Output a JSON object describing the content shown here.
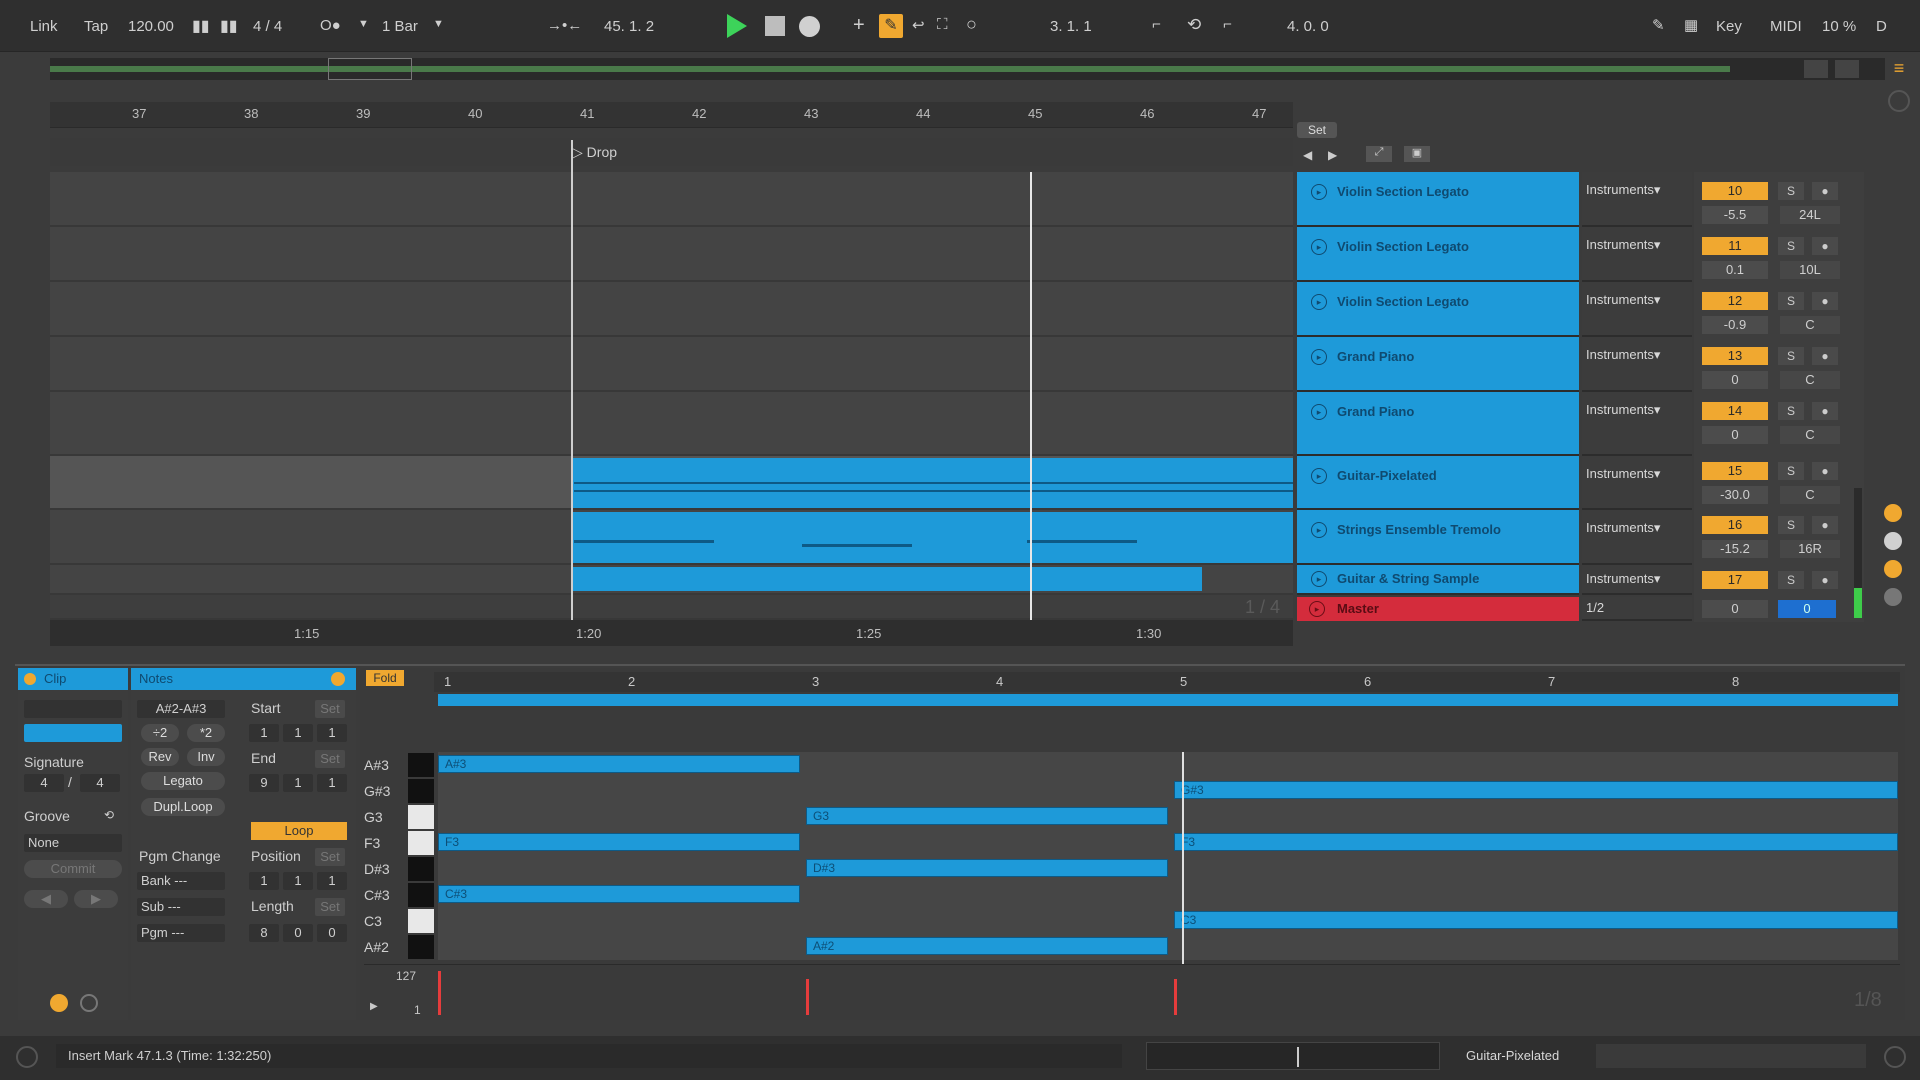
{
  "transport": {
    "link": "Link",
    "tap": "Tap",
    "tempo": "120.00",
    "signature": "4 / 4",
    "quantize": "1 Bar",
    "position": "45.  1.  2",
    "loop_start": "3.  1.  1",
    "loop_length": "4.  0.  0",
    "key_label": "Key",
    "midi_label": "MIDI",
    "cpu": "10 %",
    "disk": "D"
  },
  "arrangement": {
    "bar_numbers": [
      "37",
      "38",
      "39",
      "40",
      "41",
      "42",
      "43",
      "44",
      "45",
      "46",
      "47"
    ],
    "locator": "Drop",
    "time_labels": [
      "1:15",
      "1:20",
      "1:25",
      "1:30"
    ],
    "zoom_ratio": "1 / 4",
    "set_label": "Set"
  },
  "tracks": [
    {
      "name": "Violin Section Legato",
      "input": "Instruments▾",
      "number": "10",
      "volume": "-5.5",
      "pan": "24L"
    },
    {
      "name": "Violin Section Legato",
      "input": "Instruments▾",
      "number": "11",
      "volume": "0.1",
      "pan": "10L"
    },
    {
      "name": "Violin Section Legato",
      "input": "Instruments▾",
      "number": "12",
      "volume": "-0.9",
      "pan": "C"
    },
    {
      "name": "Grand Piano",
      "input": "Instruments▾",
      "number": "13",
      "volume": "0",
      "pan": "C"
    },
    {
      "name": "Grand Piano",
      "input": "Instruments▾",
      "number": "14",
      "volume": "0",
      "pan": "C"
    },
    {
      "name": "Guitar-Pixelated",
      "input": "Instruments▾",
      "number": "15",
      "volume": "-30.0",
      "pan": "C"
    },
    {
      "name": "Strings Ensemble Tremolo",
      "input": "Instruments▾",
      "number": "16",
      "volume": "-15.2",
      "pan": "16R"
    },
    {
      "name": "Guitar & String Sample",
      "input": "Instruments▾",
      "number": "17",
      "volume": "",
      "pan": ""
    }
  ],
  "master": {
    "name": "Master",
    "routing": "1/2",
    "volume": "0",
    "pan": "0",
    "solo_label": "S"
  },
  "clip_panel": {
    "title": "Clip",
    "signature_label": "Signature",
    "sig_num": "4",
    "sig_den": "4",
    "groove_label": "Groove",
    "groove_value": "None",
    "commit": "Commit"
  },
  "notes_panel": {
    "title": "Notes",
    "range": "A#2-A#3",
    "div2": "÷2",
    "mul2": "*2",
    "rev": "Rev",
    "inv": "Inv",
    "legato": "Legato",
    "dupl_loop": "Dupl.Loop",
    "pgm_change": "Pgm Change",
    "bank": "Bank ---",
    "sub": "Sub ---",
    "pgm": "Pgm ---",
    "start_label": "Start",
    "start_value": [
      "1",
      "1",
      "1"
    ],
    "end_label": "End",
    "end_value": [
      "9",
      "1",
      "1"
    ],
    "loop": "Loop",
    "position_label": "Position",
    "position_value": [
      "1",
      "1",
      "1"
    ],
    "length_label": "Length",
    "length_value": [
      "8",
      "0",
      "0"
    ],
    "set_label": "Set"
  },
  "piano_roll": {
    "fold": "Fold",
    "bars": [
      "1",
      "2",
      "3",
      "4",
      "5",
      "6",
      "7",
      "8"
    ],
    "keys": [
      "A#3",
      "G#3",
      "G3",
      "F3",
      "D#3",
      "C#3",
      "C3",
      "A#2"
    ],
    "notes": [
      "A#3",
      "G3",
      "D#3",
      "C#3",
      "A#2",
      "G#3",
      "F3",
      "C3",
      "F3"
    ],
    "velocity_max": "127",
    "velocity_min": "1",
    "grid": "1/8"
  },
  "status": {
    "message": "Insert Mark 47.1.3 (Time: 1:32:250)",
    "track": "Guitar-Pixelated"
  }
}
